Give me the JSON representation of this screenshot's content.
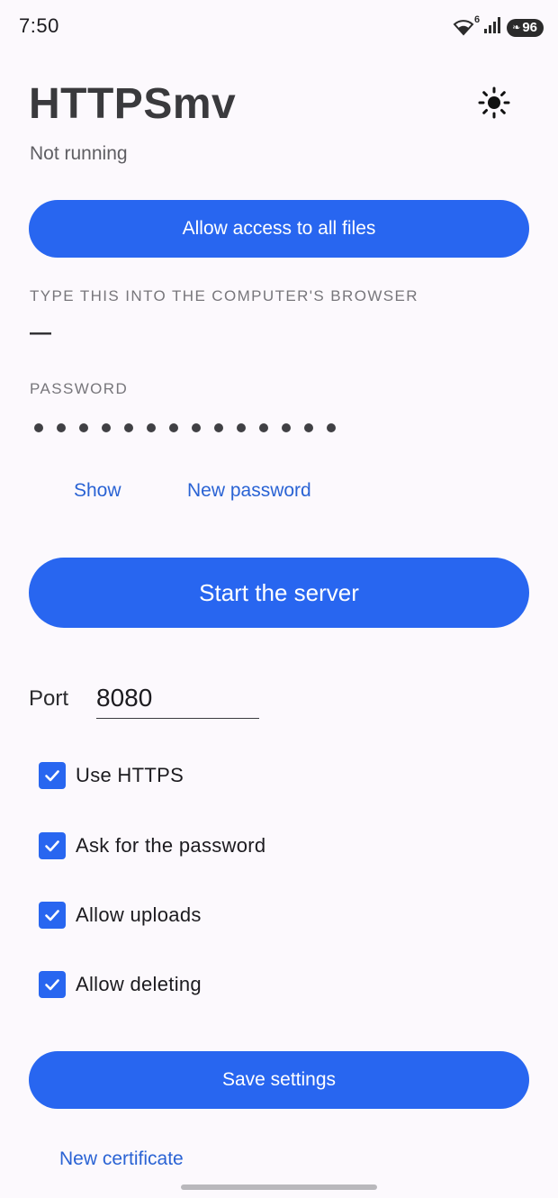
{
  "status_bar": {
    "time": "7:50",
    "wifi_badge": "6",
    "battery": "96"
  },
  "header": {
    "title": "HTTPSmv",
    "theme_icon": "sun-icon"
  },
  "server": {
    "status": "Not running"
  },
  "buttons": {
    "allow_access": "Allow access to all files",
    "start_server": "Start the server",
    "save_settings": "Save settings"
  },
  "url_section": {
    "label": "TYPE THIS INTO THE COMPUTER'S BROWSER",
    "value": "—"
  },
  "password_section": {
    "label": "PASSWORD",
    "masked_length": 14,
    "show_link": "Show",
    "new_password_link": "New password"
  },
  "settings": {
    "port_label": "Port",
    "port_value": "8080",
    "options": [
      {
        "label": "Use HTTPS",
        "checked": true
      },
      {
        "label": "Ask for the password",
        "checked": true
      },
      {
        "label": "Allow uploads",
        "checked": true
      },
      {
        "label": "Allow deleting",
        "checked": true
      }
    ]
  },
  "footer": {
    "new_certificate_link": "New certificate"
  },
  "colors": {
    "accent": "#2866f0",
    "link": "#2a63d4",
    "background": "#fcf9fd"
  }
}
